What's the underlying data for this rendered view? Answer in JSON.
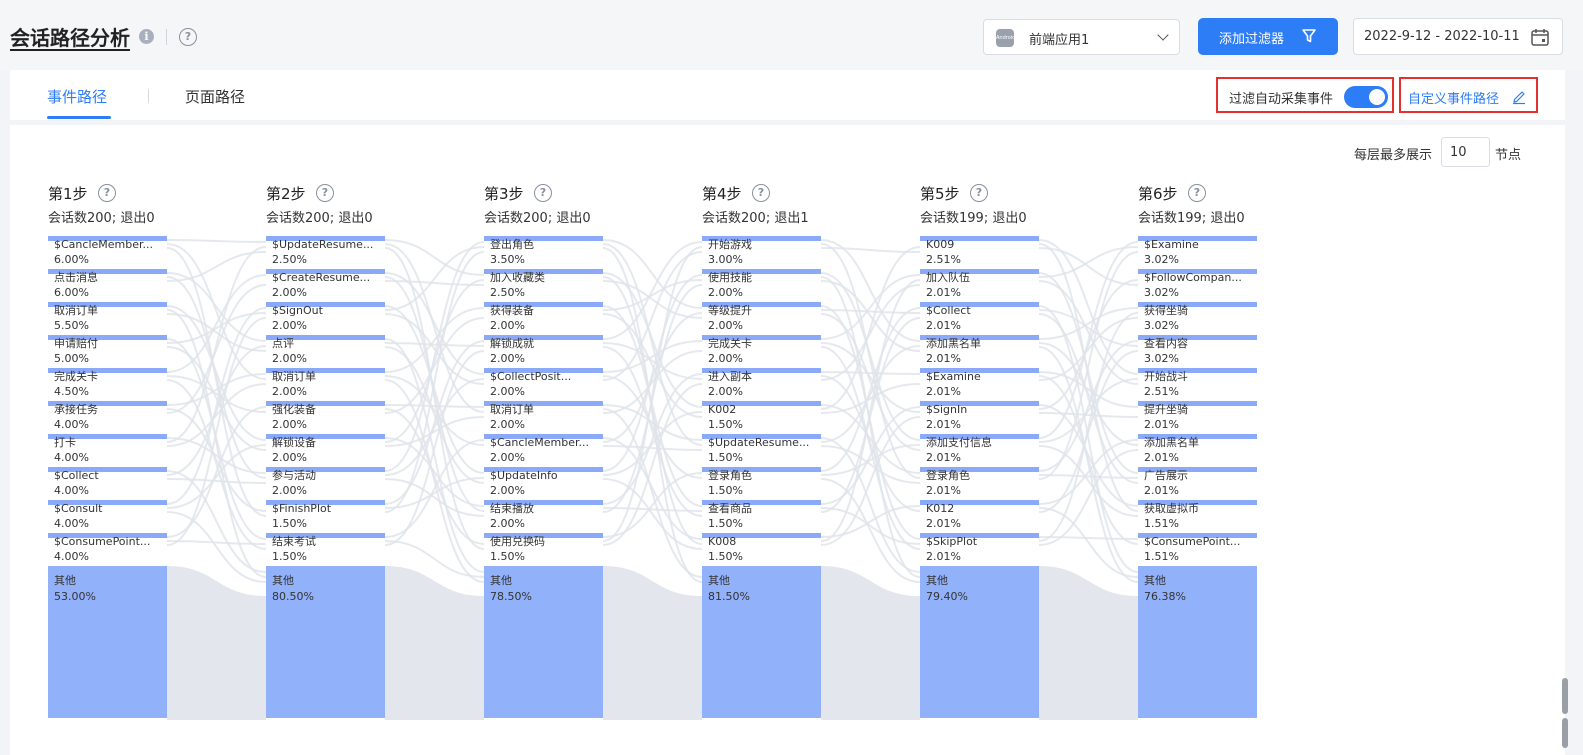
{
  "header": {
    "title": "会话路径分析",
    "info_icon": "info-icon",
    "help_icon": "help-icon",
    "app_select": {
      "logo_text": "Android",
      "value": "前端应用1"
    },
    "filter_button": "添加过滤器",
    "date_range": "2022-9-12 - 2022-10-11"
  },
  "tabs": [
    {
      "label": "事件路径",
      "active": true
    },
    {
      "label": "页面路径",
      "active": false
    }
  ],
  "toggle": {
    "label": "过滤自动采集事件",
    "on": true
  },
  "custom_path": "自定义事件路径",
  "max_per_layer": {
    "prefix": "每层最多展示",
    "value": "10",
    "suffix": "节点"
  },
  "colors": {
    "accent": "#2d7df6",
    "node": "#92b1fb",
    "node_header": "#8aa9f9",
    "link": "#e3e6ec",
    "highlight_border": "#e53030"
  },
  "steps": [
    {
      "title": "第1步",
      "sub": "会话数200; 退出0",
      "nodes": [
        {
          "label": "$CancleMember...",
          "pct": "6.00%",
          "value": 6.0
        },
        {
          "label": "点击消息",
          "pct": "6.00%",
          "value": 6.0
        },
        {
          "label": "取消订单",
          "pct": "5.50%",
          "value": 5.5
        },
        {
          "label": "申请赔付",
          "pct": "5.00%",
          "value": 5.0
        },
        {
          "label": "完成关卡",
          "pct": "4.50%",
          "value": 4.5
        },
        {
          "label": "承接任务",
          "pct": "4.00%",
          "value": 4.0
        },
        {
          "label": "打卡",
          "pct": "4.00%",
          "value": 4.0
        },
        {
          "label": "$Collect",
          "pct": "4.00%",
          "value": 4.0
        },
        {
          "label": "$Consult",
          "pct": "4.00%",
          "value": 4.0
        },
        {
          "label": "$ConsumePoint...",
          "pct": "4.00%",
          "value": 4.0
        },
        {
          "label": "其他",
          "pct": "53.00%",
          "value": 53.0
        }
      ]
    },
    {
      "title": "第2步",
      "sub": "会话数200; 退出0",
      "nodes": [
        {
          "label": "$UpdateResume...",
          "pct": "2.50%",
          "value": 2.5
        },
        {
          "label": "$CreateResume...",
          "pct": "2.00%",
          "value": 2.0
        },
        {
          "label": "$SignOut",
          "pct": "2.00%",
          "value": 2.0
        },
        {
          "label": "点评",
          "pct": "2.00%",
          "value": 2.0
        },
        {
          "label": "取消订单",
          "pct": "2.00%",
          "value": 2.0
        },
        {
          "label": "强化装备",
          "pct": "2.00%",
          "value": 2.0
        },
        {
          "label": "解锁设备",
          "pct": "2.00%",
          "value": 2.0
        },
        {
          "label": "参与活动",
          "pct": "2.00%",
          "value": 2.0
        },
        {
          "label": "$FinishPlot",
          "pct": "1.50%",
          "value": 1.5
        },
        {
          "label": "结束考试",
          "pct": "1.50%",
          "value": 1.5
        },
        {
          "label": "其他",
          "pct": "80.50%",
          "value": 80.5
        }
      ]
    },
    {
      "title": "第3步",
      "sub": "会话数200; 退出0",
      "nodes": [
        {
          "label": "登出角色",
          "pct": "3.50%",
          "value": 3.5
        },
        {
          "label": "加入收藏类",
          "pct": "2.50%",
          "value": 2.5
        },
        {
          "label": "获得装备",
          "pct": "2.00%",
          "value": 2.0
        },
        {
          "label": "解锁成就",
          "pct": "2.00%",
          "value": 2.0
        },
        {
          "label": "$CollectPosit...",
          "pct": "2.00%",
          "value": 2.0
        },
        {
          "label": "取消订单",
          "pct": "2.00%",
          "value": 2.0
        },
        {
          "label": "$CancleMember...",
          "pct": "2.00%",
          "value": 2.0
        },
        {
          "label": "$UpdateInfo",
          "pct": "2.00%",
          "value": 2.0
        },
        {
          "label": "结束播放",
          "pct": "2.00%",
          "value": 2.0
        },
        {
          "label": "使用兑换码",
          "pct": "1.50%",
          "value": 1.5
        },
        {
          "label": "其他",
          "pct": "78.50%",
          "value": 78.5
        }
      ]
    },
    {
      "title": "第4步",
      "sub": "会话数200; 退出1",
      "nodes": [
        {
          "label": "开始游戏",
          "pct": "3.00%",
          "value": 3.0
        },
        {
          "label": "使用技能",
          "pct": "2.00%",
          "value": 2.0
        },
        {
          "label": "等级提升",
          "pct": "2.00%",
          "value": 2.0
        },
        {
          "label": "完成关卡",
          "pct": "2.00%",
          "value": 2.0
        },
        {
          "label": "进入副本",
          "pct": "2.00%",
          "value": 2.0
        },
        {
          "label": "K002",
          "pct": "1.50%",
          "value": 1.5
        },
        {
          "label": "$UpdateResume...",
          "pct": "1.50%",
          "value": 1.5
        },
        {
          "label": "登录角色",
          "pct": "1.50%",
          "value": 1.5
        },
        {
          "label": "查看商品",
          "pct": "1.50%",
          "value": 1.5
        },
        {
          "label": "K008",
          "pct": "1.50%",
          "value": 1.5
        },
        {
          "label": "其他",
          "pct": "81.50%",
          "value": 81.5
        }
      ]
    },
    {
      "title": "第5步",
      "sub": "会话数199; 退出0",
      "nodes": [
        {
          "label": "K009",
          "pct": "2.51%",
          "value": 2.51
        },
        {
          "label": "加入队伍",
          "pct": "2.01%",
          "value": 2.01
        },
        {
          "label": "$Collect",
          "pct": "2.01%",
          "value": 2.01
        },
        {
          "label": "添加黑名单",
          "pct": "2.01%",
          "value": 2.01
        },
        {
          "label": "$Examine",
          "pct": "2.01%",
          "value": 2.01
        },
        {
          "label": "$SignIn",
          "pct": "2.01%",
          "value": 2.01
        },
        {
          "label": "添加支付信息",
          "pct": "2.01%",
          "value": 2.01
        },
        {
          "label": "登录角色",
          "pct": "2.01%",
          "value": 2.01
        },
        {
          "label": "K012",
          "pct": "2.01%",
          "value": 2.01
        },
        {
          "label": "$SkipPlot",
          "pct": "2.01%",
          "value": 2.01
        },
        {
          "label": "其他",
          "pct": "79.40%",
          "value": 79.4
        }
      ]
    },
    {
      "title": "第6步",
      "sub": "会话数199; 退出0",
      "nodes": [
        {
          "label": "$Examine",
          "pct": "3.02%",
          "value": 3.02
        },
        {
          "label": "$FollowCompan...",
          "pct": "3.02%",
          "value": 3.02
        },
        {
          "label": "获得坐骑",
          "pct": "3.02%",
          "value": 3.02
        },
        {
          "label": "查看内容",
          "pct": "3.02%",
          "value": 3.02
        },
        {
          "label": "开始战斗",
          "pct": "2.51%",
          "value": 2.51
        },
        {
          "label": "提升坐骑",
          "pct": "2.01%",
          "value": 2.01
        },
        {
          "label": "添加黑名单",
          "pct": "2.01%",
          "value": 2.01
        },
        {
          "label": "广告展示",
          "pct": "2.01%",
          "value": 2.01
        },
        {
          "label": "获取虚拟币",
          "pct": "1.51%",
          "value": 1.51
        },
        {
          "label": "$ConsumePoint...",
          "pct": "1.51%",
          "value": 1.51
        },
        {
          "label": "其他",
          "pct": "76.38%",
          "value": 76.38
        }
      ]
    }
  ]
}
